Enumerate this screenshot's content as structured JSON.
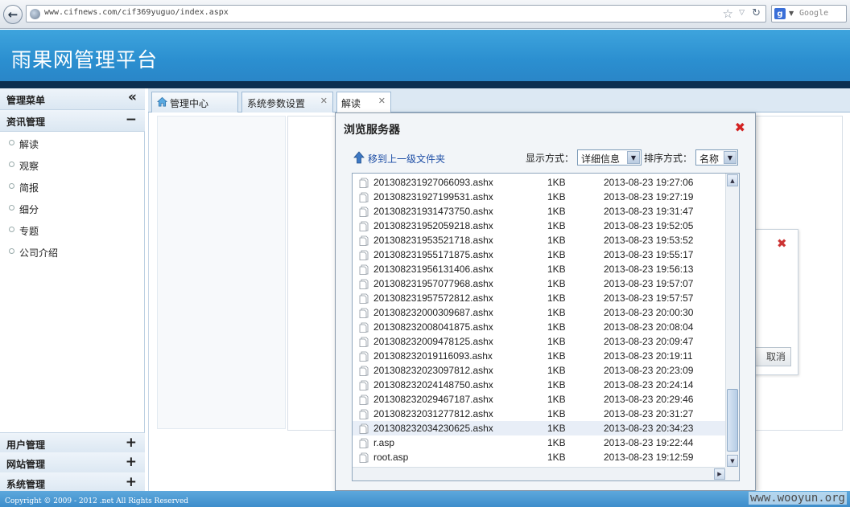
{
  "browser": {
    "url": "www.cifnews.com/cif369yuguo/index.aspx",
    "search_placeholder": "Google"
  },
  "header": {
    "title": "雨果网管理平台"
  },
  "sidebar": {
    "title": "管理菜单",
    "collapse_glyph": "«",
    "sections": {
      "news": {
        "label": "资讯管理",
        "sign": "−"
      },
      "users": {
        "label": "用户管理",
        "sign": "+"
      },
      "site": {
        "label": "网站管理",
        "sign": "+"
      },
      "system": {
        "label": "系统管理",
        "sign": "+"
      }
    },
    "items": [
      "解读",
      "观察",
      "简报",
      "细分",
      "专题",
      "公司介绍"
    ]
  },
  "tabs": [
    {
      "label": "管理中心",
      "closable": false
    },
    {
      "label": "系统参数设置",
      "closable": true
    },
    {
      "label": "解读",
      "closable": true
    }
  ],
  "background_dialog": {
    "cancel_label": "取消"
  },
  "browse_dialog": {
    "title": "浏览服务器",
    "up_link": "移到上一级文件夹",
    "display_label": "显示方式：",
    "display_value": "详细信息",
    "sort_label": "排序方式：",
    "sort_value": "名称",
    "files": [
      {
        "name": "201308231927066093.ashx",
        "size": "1KB",
        "date": "2013-08-23 19:27:06"
      },
      {
        "name": "201308231927199531.ashx",
        "size": "1KB",
        "date": "2013-08-23 19:27:19"
      },
      {
        "name": "201308231931473750.ashx",
        "size": "1KB",
        "date": "2013-08-23 19:31:47"
      },
      {
        "name": "201308231952059218.ashx",
        "size": "1KB",
        "date": "2013-08-23 19:52:05"
      },
      {
        "name": "201308231953521718.ashx",
        "size": "1KB",
        "date": "2013-08-23 19:53:52"
      },
      {
        "name": "201308231955171875.ashx",
        "size": "1KB",
        "date": "2013-08-23 19:55:17"
      },
      {
        "name": "201308231956131406.ashx",
        "size": "1KB",
        "date": "2013-08-23 19:56:13"
      },
      {
        "name": "201308231957077968.ashx",
        "size": "1KB",
        "date": "2013-08-23 19:57:07"
      },
      {
        "name": "201308231957572812.ashx",
        "size": "1KB",
        "date": "2013-08-23 19:57:57"
      },
      {
        "name": "201308232000309687.ashx",
        "size": "1KB",
        "date": "2013-08-23 20:00:30"
      },
      {
        "name": "201308232008041875.ashx",
        "size": "1KB",
        "date": "2013-08-23 20:08:04"
      },
      {
        "name": "201308232009478125.ashx",
        "size": "1KB",
        "date": "2013-08-23 20:09:47"
      },
      {
        "name": "201308232019116093.ashx",
        "size": "1KB",
        "date": "2013-08-23 20:19:11"
      },
      {
        "name": "201308232023097812.ashx",
        "size": "1KB",
        "date": "2013-08-23 20:23:09"
      },
      {
        "name": "201308232024148750.ashx",
        "size": "1KB",
        "date": "2013-08-23 20:24:14"
      },
      {
        "name": "201308232029467187.ashx",
        "size": "1KB",
        "date": "2013-08-23 20:29:46"
      },
      {
        "name": "201308232031277812.ashx",
        "size": "1KB",
        "date": "2013-08-23 20:31:27"
      },
      {
        "name": "201308232034230625.ashx",
        "size": "1KB",
        "date": "2013-08-23 20:34:23",
        "selected": true
      },
      {
        "name": "r.asp",
        "size": "1KB",
        "date": "2013-08-23 19:22:44"
      },
      {
        "name": "root.asp",
        "size": "1KB",
        "date": "2013-08-23 19:12:59"
      }
    ]
  },
  "footer": {
    "copyright": "Copyright © 2009 - 2012 .net All Rights Reserved"
  },
  "watermark": "www.wooyun.org",
  "colors": {
    "header_blue": "#2b8fd0",
    "dark_stripe": "#0d2f50",
    "link_blue": "#1f4fa6",
    "close_red": "#d32222"
  }
}
